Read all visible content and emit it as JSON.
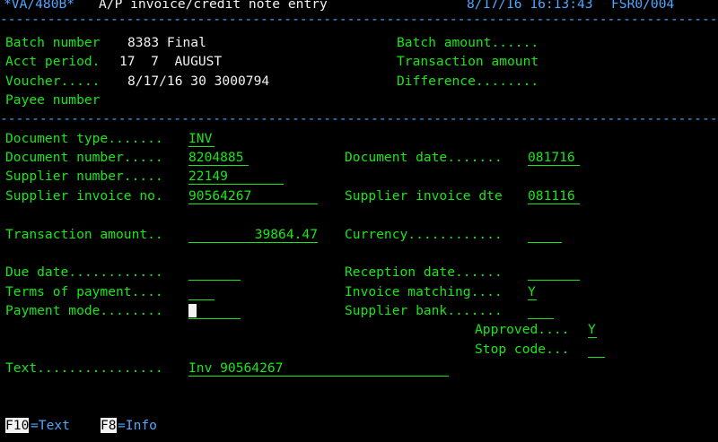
{
  "header": {
    "program": "*VA/480B*",
    "title": "A/P invoice/credit note entry",
    "datetime": "8/17/16 16:13:43",
    "screen_id": "FSR0/004"
  },
  "separator": "-------------------------------------------------------------------------------------------------------------------------------",
  "batch": {
    "batch_number_label": "Batch number",
    "batch_number_value": "8383 Final",
    "acct_period_label": "Acct period.",
    "acct_period_value": "17  7  AUGUST",
    "voucher_label": "Voucher.....",
    "voucher_value": "8/17/16 30 3000794",
    "payee_label": "Payee number",
    "batch_amount_label": "Batch amount......",
    "transaction_amount_label": "Transaction amount",
    "difference_label": "Difference........"
  },
  "form": {
    "document_type_label": "Document type.......",
    "document_type_value": "INV",
    "document_number_label": "Document number.....",
    "document_number_value": "8204885",
    "supplier_number_label": "Supplier number.....",
    "supplier_number_value": "22149",
    "supplier_invoice_no_label": "Supplier invoice no.",
    "supplier_invoice_no_value": "90564267",
    "transaction_amount_label": "Transaction amount..",
    "transaction_amount_value": "39864.47",
    "due_date_label": "Due date............",
    "due_date_value": "",
    "terms_label": "Terms of payment....",
    "terms_value": "",
    "payment_mode_label": "Payment mode........",
    "payment_mode_value": "",
    "text_label": "Text................",
    "text_value": "Inv 90564267",
    "document_date_label": "Document date.......",
    "document_date_value": "081716",
    "supplier_invoice_dte_label": "Supplier invoice dte",
    "supplier_invoice_dte_value": "081116",
    "currency_label": "Currency............",
    "currency_value": "",
    "reception_date_label": "Reception date......",
    "reception_date_value": "",
    "invoice_matching_label": "Invoice matching....",
    "invoice_matching_value": "Y",
    "supplier_bank_label": "Supplier bank.......",
    "supplier_bank_value": "",
    "approved_label": "Approved....",
    "approved_value": "Y",
    "stop_code_label": "Stop code...",
    "stop_code_value": ""
  },
  "function_keys": [
    {
      "key": "F10",
      "label": "=Text"
    },
    {
      "key": "F8",
      "label": "=Info"
    }
  ]
}
